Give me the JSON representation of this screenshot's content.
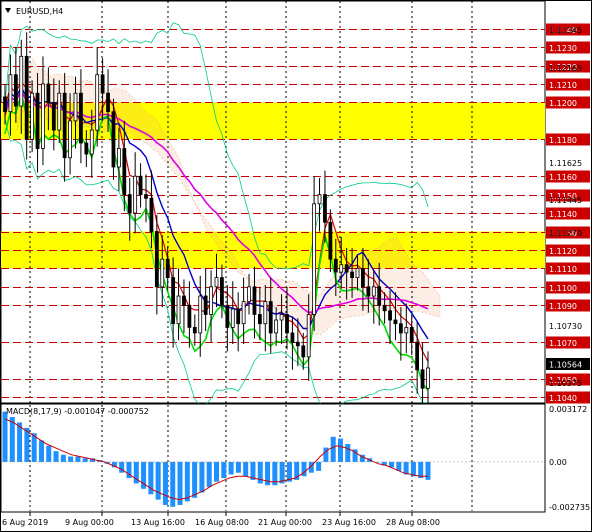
{
  "header": {
    "symbol": "EURUSD,H4",
    "macd_label": "MACD(8,17,9) -0.001047 -0.000752"
  },
  "colors": {
    "level_line": "#cc0000",
    "level_badge": "#cc0000",
    "yellow_zone": "#ffff00",
    "cloud": "#f0a070",
    "magenta": "#e000e0",
    "green": "#00dd00",
    "red": "#dd0000",
    "blue": "#0000cc",
    "bollinger": "#00cc88",
    "macd_bars": "#1e90ff",
    "macd_signal": "#cc0000"
  },
  "chart_data": [
    {
      "type": "line",
      "title": "EURUSD,H4",
      "ylim": [
        1.1037,
        1.1255
      ],
      "x_tick_labels": [
        "6 Aug 2019",
        "9 Aug 00:00",
        "13 Aug 16:00",
        "16 Aug 08:00",
        "21 Aug 00:00",
        "23 Aug 16:00",
        "28 Aug 08:00"
      ],
      "levels": [
        1.124,
        1.123,
        1.122,
        1.121,
        1.12,
        1.118,
        1.116,
        1.115,
        1.114,
        1.113,
        1.112,
        1.111,
        1.11,
        1.109,
        1.107,
        1.105,
        1.104
      ],
      "secondary_price_labels": [
        "1.12345",
        "1.12165",
        "1.11625",
        "1.11445",
        "1.11270",
        "1.10730",
        "1.10375"
      ],
      "current_price": "1.10564",
      "yellow_zones": [
        [
          1.118,
          1.12
        ],
        [
          1.111,
          1.113
        ]
      ],
      "close": [
        1.1195,
        1.1215,
        1.1198,
        1.1225,
        1.118,
        1.1205,
        1.1175,
        1.121,
        1.12,
        1.1185,
        1.1205,
        1.117,
        1.119,
        1.1205,
        1.1178,
        1.1172,
        1.1185,
        1.1215,
        1.1205,
        1.1195,
        1.1165,
        1.1175,
        1.115,
        1.114,
        1.116,
        1.115,
        1.1148,
        1.113,
        1.11,
        1.1115,
        1.1105,
        1.108,
        1.1095,
        1.109,
        1.1078,
        1.1075,
        1.1095,
        1.1085,
        1.11,
        1.1105,
        1.109,
        1.1078,
        1.1088,
        1.108,
        1.1092,
        1.11,
        1.1085,
        1.108,
        1.1092,
        1.1075,
        1.1082,
        1.1085,
        1.1075,
        1.107,
        1.1068,
        1.1062,
        1.1085,
        1.1145,
        1.115,
        1.1135,
        1.1115,
        1.1108,
        1.1112,
        1.1108,
        1.1105,
        1.111,
        1.11,
        1.1095,
        1.11,
        1.109,
        1.1087,
        1.1082,
        1.108,
        1.1075,
        1.1078,
        1.107,
        1.1055,
        1.1045,
        1.1056
      ]
    },
    {
      "type": "bar",
      "title": "MACD(8,17,9)",
      "ylim": [
        -0.002735,
        0.003172
      ],
      "tick_labels": [
        "0.003172",
        "0.00",
        "-0.002735"
      ],
      "values": [
        0.0028,
        0.0025,
        0.0022,
        0.0019,
        0.0016,
        0.0012,
        0.0009,
        0.0006,
        0.0004,
        0.0003,
        0.0003,
        0.0002,
        0.0002,
        0.0001,
        -0.0001,
        -0.0003,
        -0.0006,
        -0.0009,
        -0.0012,
        -0.0015,
        -0.0018,
        -0.0021,
        -0.0024,
        -0.0025,
        -0.0024,
        -0.0022,
        -0.002,
        -0.0017,
        -0.0014,
        -0.0011,
        -0.0009,
        -0.0007,
        -0.0006,
        -0.0008,
        -0.001,
        -0.0012,
        -0.0013,
        -0.0013,
        -0.0012,
        -0.0011,
        -0.001,
        -0.0008,
        -0.0006,
        -0.0005,
        0.0008,
        0.0014,
        0.0013,
        0.001,
        0.0007,
        0.0004,
        0.0002,
        0.0,
        -0.0002,
        -0.0003,
        -0.0005,
        -0.0007,
        -0.0008,
        -0.0009,
        -0.001
      ],
      "signal": [
        0.0024,
        0.0022,
        0.0019,
        0.0016,
        0.0013,
        0.001,
        0.0008,
        0.0006,
        0.0004,
        0.0003,
        0.0002,
        0.0001,
        0.0,
        -0.0002,
        -0.0004,
        -0.0007,
        -0.001,
        -0.0013,
        -0.0016,
        -0.0018,
        -0.002,
        -0.0021,
        -0.002,
        -0.0018,
        -0.0016,
        -0.0013,
        -0.0011,
        -0.0009,
        -0.0008,
        -0.0008,
        -0.0009,
        -0.001,
        -0.0011,
        -0.0011,
        -0.001,
        -0.0009,
        -0.0006,
        -0.0002,
        0.0003,
        0.0007,
        0.0009,
        0.0008,
        0.0006,
        0.0003,
        0.0001,
        -0.0001,
        -0.0002,
        -0.0004,
        -0.0006,
        -0.0007,
        -0.0008,
        -0.0008
      ]
    }
  ]
}
